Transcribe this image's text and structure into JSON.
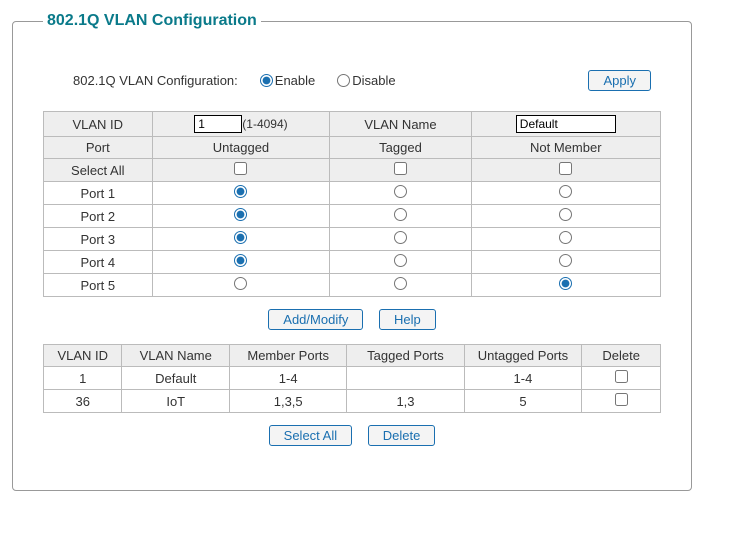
{
  "title": "802.1Q VLAN Configuration",
  "config": {
    "label": "802.1Q VLAN Configuration:",
    "enable_label": "Enable",
    "disable_label": "Disable",
    "state": "enable",
    "apply_label": "Apply"
  },
  "form": {
    "headers": {
      "vlan_id": "VLAN ID",
      "vlan_id_hint": "(1-4094)",
      "vlan_name": "VLAN Name",
      "port": "Port",
      "untagged": "Untagged",
      "tagged": "Tagged",
      "not_member": "Not Member",
      "select_all": "Select All"
    },
    "vlan_id_value": "1",
    "vlan_name_value": "Default",
    "select_all": {
      "untagged": false,
      "tagged": false,
      "not_member": false
    },
    "ports": [
      {
        "name": "Port 1",
        "state": "untagged"
      },
      {
        "name": "Port 2",
        "state": "untagged"
      },
      {
        "name": "Port 3",
        "state": "untagged"
      },
      {
        "name": "Port 4",
        "state": "untagged"
      },
      {
        "name": "Port 5",
        "state": "not_member"
      }
    ],
    "add_modify_label": "Add/Modify",
    "help_label": "Help"
  },
  "list": {
    "headers": {
      "vlan_id": "VLAN ID",
      "vlan_name": "VLAN Name",
      "member_ports": "Member Ports",
      "tagged_ports": "Tagged Ports",
      "untagged_ports": "Untagged Ports",
      "delete": "Delete"
    },
    "rows": [
      {
        "vlan_id": "1",
        "vlan_name": "Default",
        "member_ports": "1-4",
        "tagged_ports": "",
        "untagged_ports": "1-4",
        "delete_checked": false
      },
      {
        "vlan_id": "36",
        "vlan_name": "IoT",
        "member_ports": "1,3,5",
        "tagged_ports": "1,3",
        "untagged_ports": "5",
        "delete_checked": false
      }
    ],
    "select_all_label": "Select All",
    "delete_label": "Delete"
  }
}
